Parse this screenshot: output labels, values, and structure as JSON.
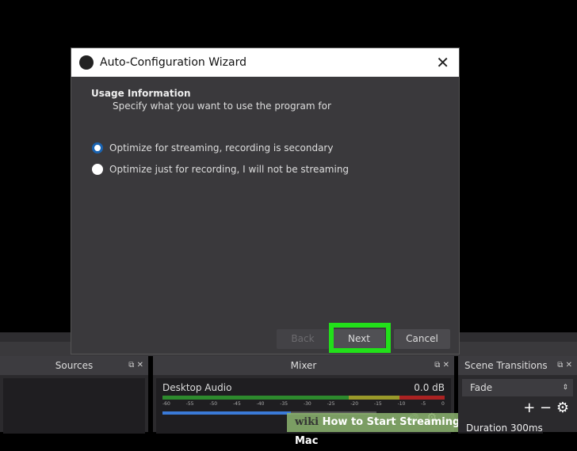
{
  "dialog": {
    "title": "Auto-Configuration Wizard",
    "heading": "Usage Information",
    "subtitle": "Specify what you want to use the program for",
    "options": [
      {
        "label": "Optimize for streaming, recording is secondary",
        "selected": true
      },
      {
        "label": "Optimize just for recording, I will not be streaming",
        "selected": false
      }
    ],
    "back": "Back",
    "next": "Next",
    "cancel": "Cancel",
    "highlight_color": "#22e01a"
  },
  "docks": {
    "sources": "Sources",
    "mixer": "Mixer",
    "transitions": "Scene Transitions"
  },
  "mixer": {
    "source": "Desktop Audio",
    "level": "0.0 dB",
    "ticks": [
      "-60",
      "-55",
      "-50",
      "-45",
      "-40",
      "-35",
      "-30",
      "-25",
      "-20",
      "-15",
      "-10",
      "-5",
      "0"
    ],
    "volume_percent": 60
  },
  "transitions": {
    "selected": "Fade",
    "duration_label": "Duration",
    "duration": "300ms"
  },
  "watermark": {
    "brand": "wiki",
    "text": "How to Start Streaming on Twitch on PC or Mac"
  }
}
